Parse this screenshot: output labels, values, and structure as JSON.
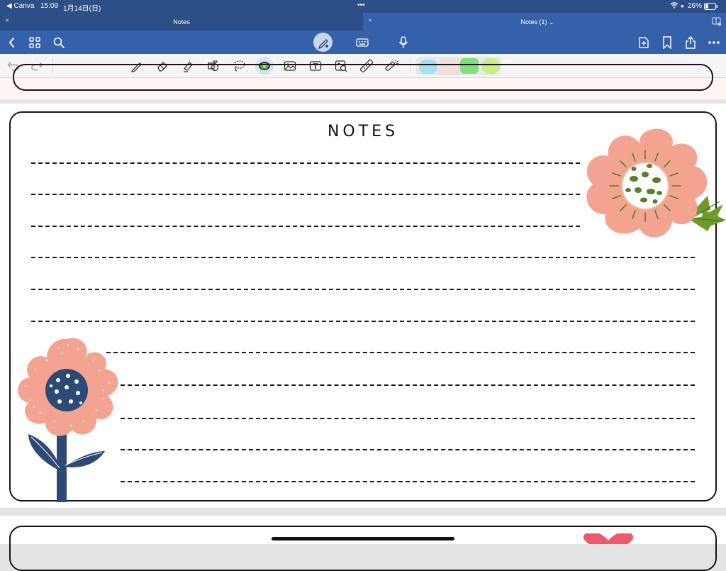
{
  "status_bar": {
    "back_app": "◀ Canva",
    "time": "15:09",
    "date": "1月14日(日)",
    "dots": "•••",
    "battery": "26%"
  },
  "tabs": [
    {
      "label": "Notes",
      "close": "×"
    },
    {
      "label": "Notes (1) ⌄",
      "close": "×"
    }
  ],
  "navbar": {
    "icons": [
      "chevron-left-icon",
      "grid-icon",
      "search-icon",
      "pen-icon",
      "keyboard-icon",
      "mic-icon",
      "add-page-icon",
      "bookmark-icon",
      "share-icon",
      "more-icon"
    ]
  },
  "toolbar": {
    "tools": [
      "undo-icon",
      "redo-icon",
      "pen-tool",
      "eraser-tool",
      "highlighter-tool",
      "shapes-tool",
      "lasso-tool",
      "sticker-tool",
      "image-tool",
      "text-tool",
      "camera-tool",
      "ruler-tool",
      "laser-tool"
    ],
    "swatches": [
      "#a4e0ef",
      "#f7dcdc",
      "#7de07b",
      "#c7ef83"
    ],
    "accent": "#3461a9"
  },
  "notes_page": {
    "title": "NOTES",
    "line_count": 11,
    "flower_colors": {
      "petal": "#f3a490",
      "navy": "#2d4a76",
      "olive": "#5a7d2a",
      "leaf": "#6f9a2a"
    }
  },
  "next_page": {
    "decoration": "heart"
  }
}
